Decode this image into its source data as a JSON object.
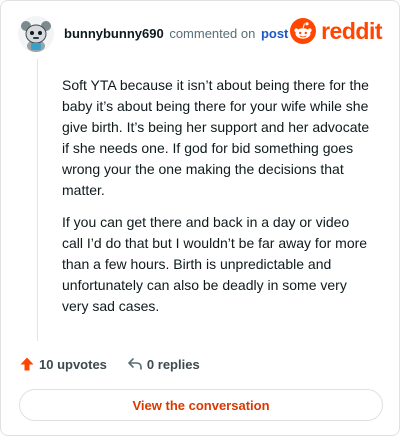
{
  "header": {
    "username": "bunnybunny690",
    "action_text": "commented on",
    "post_link": "post",
    "brand_name": "reddit"
  },
  "comment": {
    "paragraphs": [
      "Soft YTA because it isn’t about being there for the baby it’s about being there for your wife while she give birth. It’s being her support and her advocate if she needs one. If god for bid something goes wrong your the one making the decisions that matter.",
      "If you can get there and back in a day or video call I’d do that but I wouldn’t be far away for more than a few hours. Birth is unpredictable and unfortunately can also be deadly in some very very sad cases."
    ]
  },
  "actions": {
    "upvotes": "10 upvotes",
    "replies": "0 replies"
  },
  "footer": {
    "button_label": "View the conversation"
  },
  "icons": {
    "avatar": "snoo-avatar-icon",
    "brand": "reddit-logo-icon",
    "upvote": "upvote-arrow-icon",
    "reply": "reply-arrow-icon"
  },
  "colors": {
    "brand_orange": "#ff4500",
    "button_text": "#d93900",
    "link_blue": "#1f57c3",
    "upvote_orange": "#ff4500"
  }
}
